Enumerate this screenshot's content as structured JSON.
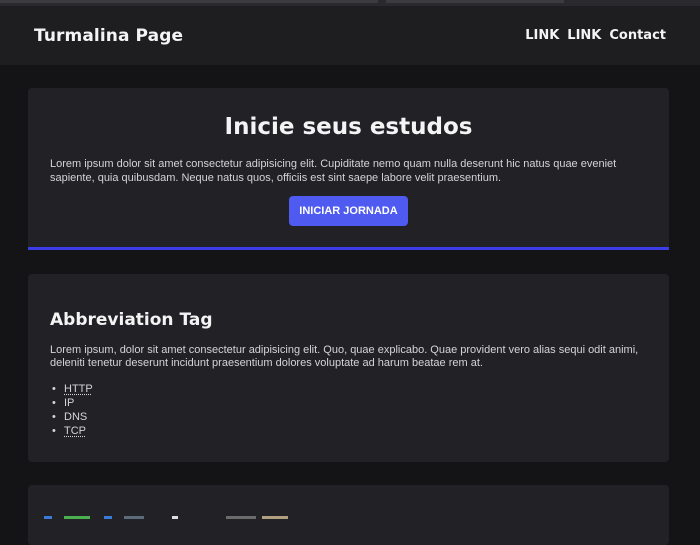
{
  "navbar": {
    "brand": "Turmalina Page",
    "links": [
      "LINK",
      "LINK",
      "Contact"
    ]
  },
  "hero": {
    "title": "Inicie seus estudos",
    "body": "Lorem ipsum dolor sit amet consectetur adipisicing elit. Cupiditate nemo quam nulla deserunt hic natus quae eveniet sapiente, quia quibusdam. Neque natus quos, officiis est sint saepe labore velit praesentium.",
    "cta_label": "INICIAR JORNADA"
  },
  "abbr_section": {
    "title": "Abbreviation Tag",
    "body": "Lorem ipsum, dolor sit amet consectetur adipisicing elit. Quo, quae explicabo. Quae provident vero alias sequi odit animi, deleniti tenetur deserunt incidunt praesentium dolores voluptate ad harum beatae rem at.",
    "items": [
      "HTTP",
      "IP",
      "DNS",
      "TCP"
    ]
  },
  "colors": {
    "accent": "#4f5bf0",
    "hero_border": "#3b3ee6",
    "background": "#141416",
    "card": "#222226"
  }
}
